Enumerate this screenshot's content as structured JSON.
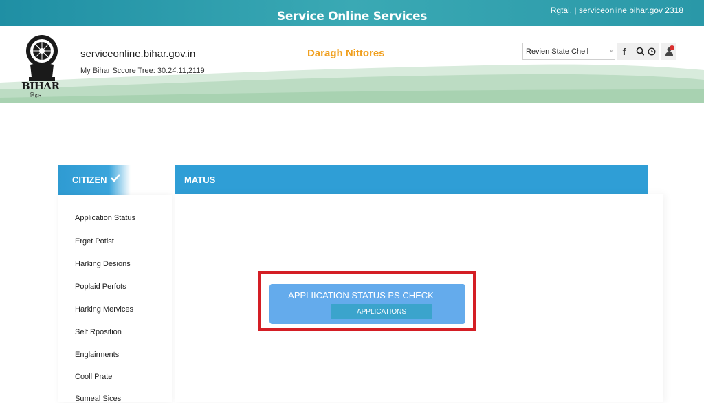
{
  "topbar": {
    "title": "Service Online Services",
    "right_text": "Rgtal. | serviceonline bihar.gov 2318"
  },
  "header": {
    "emblem_text": "BIHAR",
    "emblem_subtext": "बिहार",
    "domain": "serviceonline.bihar.gov.in",
    "tree_line": "My Bihar Sccore Tree: 30.24̈.11,2119",
    "center_text": "Daragh Nittores"
  },
  "search": {
    "text": "Revien  State Chell",
    "dot": "◦"
  },
  "icons": {
    "facebook": "f",
    "search": "search-icon",
    "clock": "clock-icon",
    "user": "user-icon"
  },
  "sidebar": {
    "heading": "CITIZEN",
    "items": [
      {
        "label": "Application Status"
      },
      {
        "label": "Erget Potist"
      },
      {
        "label": "Harking Desions"
      },
      {
        "label": "Poplaid Perfots"
      },
      {
        "label": "Harking Mervices"
      },
      {
        "label": "Self Rposition"
      },
      {
        "label": "Englairments"
      },
      {
        "label": "Cooll Prate"
      },
      {
        "label": "Sumeal Sices"
      }
    ]
  },
  "main": {
    "heading": "MATUS",
    "card": {
      "title": "APPLIICATION STATUS PS CHECK",
      "button": "APPLICATIONS"
    }
  },
  "colors": {
    "topbar": "#2a98a8",
    "sidebar_header": "#2f9bd2",
    "main_header": "#2f9ed6",
    "highlight": "#d41e25",
    "card": "#64abec",
    "card_button": "#3ba4cc",
    "accent_text": "#f0a020"
  }
}
